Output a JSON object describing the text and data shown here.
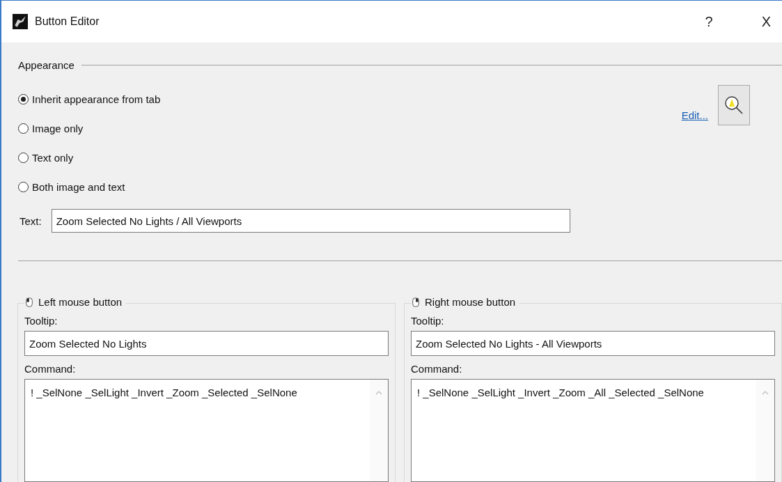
{
  "window": {
    "title": "Button Editor",
    "help": "?",
    "close": "X"
  },
  "appearance": {
    "title": "Appearance",
    "edit_link": "Edit...",
    "options": [
      {
        "label": "Inherit appearance from tab",
        "selected": true
      },
      {
        "label": "Image only",
        "selected": false
      },
      {
        "label": "Text only",
        "selected": false
      },
      {
        "label": "Both image and text",
        "selected": false
      }
    ],
    "text_label": "Text:",
    "text_value": "Zoom Selected No Lights / All Viewports"
  },
  "mouse_groups": [
    {
      "kind": "left",
      "title": "Left mouse button",
      "tooltip_label": "Tooltip:",
      "tooltip": "Zoom Selected No Lights",
      "command_label": "Command:",
      "command": "! _SelNone _SelLight _Invert _Zoom _Selected _SelNone"
    },
    {
      "kind": "right",
      "title": "Right mouse button",
      "tooltip_label": "Tooltip:",
      "tooltip": "Zoom Selected No Lights - All Viewports",
      "command_label": "Command:",
      "command": "! _SelNone _SelLight _Invert _Zoom _All _Selected _SelNone"
    }
  ]
}
